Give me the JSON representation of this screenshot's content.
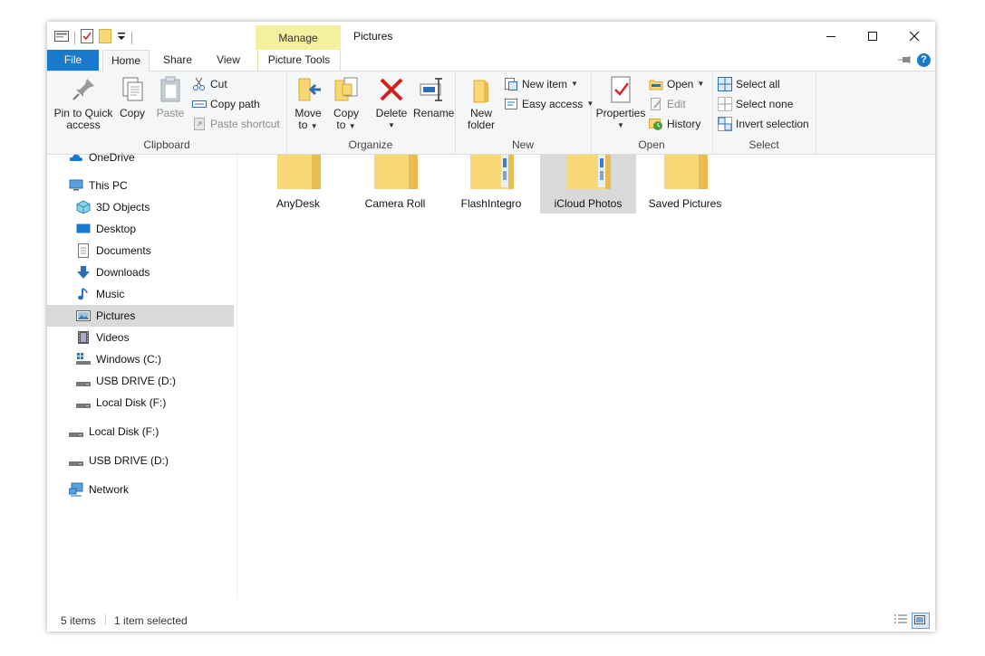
{
  "window": {
    "title": "Pictures"
  },
  "context_tab": {
    "label": "Manage"
  },
  "tabs": {
    "file": "File",
    "home": "Home",
    "share": "Share",
    "view": "View",
    "picture_tools": "Picture Tools"
  },
  "ribbon": {
    "clipboard": {
      "label": "Clipboard",
      "pin_line1": "Pin to Quick",
      "pin_line2": "access",
      "copy": "Copy",
      "paste": "Paste",
      "cut": "Cut",
      "copy_path": "Copy path",
      "paste_shortcut": "Paste shortcut"
    },
    "organize": {
      "label": "Organize",
      "move_line1": "Move",
      "move_line2": "to",
      "copy_line1": "Copy",
      "copy_line2": "to",
      "delete": "Delete",
      "rename": "Rename"
    },
    "new": {
      "label": "New",
      "folder_line1": "New",
      "folder_line2": "folder",
      "new_item": "New item",
      "easy_access": "Easy access"
    },
    "open": {
      "label": "Open",
      "properties": "Properties",
      "open": "Open",
      "edit": "Edit",
      "history": "History"
    },
    "select": {
      "label": "Select",
      "select_all": "Select all",
      "select_none": "Select none",
      "invert": "Invert selection"
    }
  },
  "nav": {
    "onedrive": "OneDrive",
    "this_pc": "This PC",
    "objects3d": "3D Objects",
    "desktop": "Desktop",
    "documents": "Documents",
    "downloads": "Downloads",
    "music": "Music",
    "pictures": "Pictures",
    "videos": "Videos",
    "windows_c": "Windows (C:)",
    "usb_d": "USB DRIVE (D:)",
    "local_f": "Local Disk (F:)",
    "local_f2": "Local Disk (F:)",
    "usb_d2": "USB DRIVE (D:)",
    "network": "Network"
  },
  "items": [
    "AnyDesk",
    "Camera Roll",
    "FlashIntegro",
    "iCloud Photos",
    "Saved Pictures"
  ],
  "status": {
    "count": "5 items",
    "selected": "1 item selected"
  },
  "colors": {
    "accent": "#1979ca",
    "manage": "#f4f0a0",
    "folder": "#f8d775",
    "selection": "#d9d9d9"
  }
}
